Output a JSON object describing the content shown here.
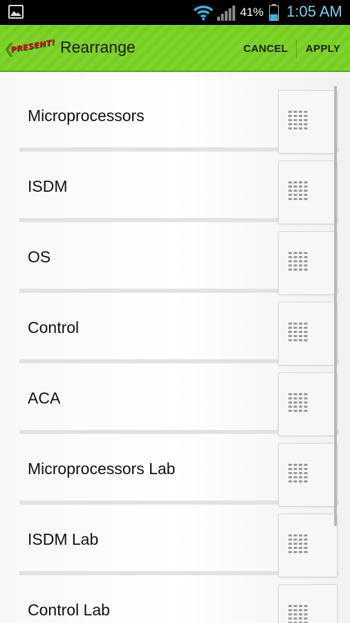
{
  "status_bar": {
    "battery_percent": "41%",
    "time": "1:05 AM",
    "battery_level": 0.41,
    "icons": [
      "image-icon",
      "wifi-icon",
      "signal-icon",
      "battery-icon"
    ]
  },
  "action_bar": {
    "logo_text": "PRESENT!",
    "title": "Rearrange",
    "cancel_label": "CANCEL",
    "apply_label": "APPLY",
    "accent_color": "#7fd42c"
  },
  "list": {
    "items": [
      {
        "label": "Microprocessors"
      },
      {
        "label": "ISDM"
      },
      {
        "label": "OS"
      },
      {
        "label": "Control"
      },
      {
        "label": "ACA"
      },
      {
        "label": "Microprocessors Lab"
      },
      {
        "label": "ISDM Lab"
      },
      {
        "label": "Control Lab"
      }
    ]
  }
}
